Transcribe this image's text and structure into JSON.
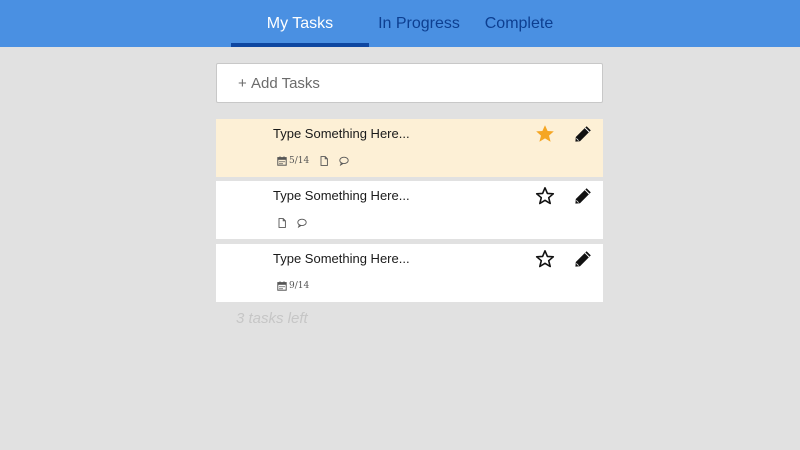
{
  "tabs": [
    {
      "label": "My Tasks",
      "active": true
    },
    {
      "label": "In Progress",
      "active": false
    },
    {
      "label": "Complete",
      "active": false
    }
  ],
  "add_task": {
    "plus": "+",
    "label": "Add Tasks"
  },
  "tasks": [
    {
      "title": "Type Something Here...",
      "date": "5/14",
      "has_date": true,
      "has_file": true,
      "has_comment": true,
      "starred": true,
      "highlight": true
    },
    {
      "title": "Type Something Here...",
      "date": "",
      "has_date": false,
      "has_file": true,
      "has_comment": true,
      "starred": false,
      "highlight": false
    },
    {
      "title": "Type Something Here...",
      "date": "9/14",
      "has_date": true,
      "has_file": false,
      "has_comment": false,
      "starred": false,
      "highlight": false
    }
  ],
  "footer": {
    "tasks_left": "3 tasks left"
  },
  "colors": {
    "accent": "#4a90e2",
    "tab_inactive": "#0d3f91",
    "star_active": "#f5a623",
    "highlight_bg": "#fdf0d6"
  },
  "icons": {
    "star": "star-icon",
    "edit": "pencil-icon",
    "calendar": "calendar-icon",
    "file": "document-icon",
    "comment": "comment-icon"
  }
}
